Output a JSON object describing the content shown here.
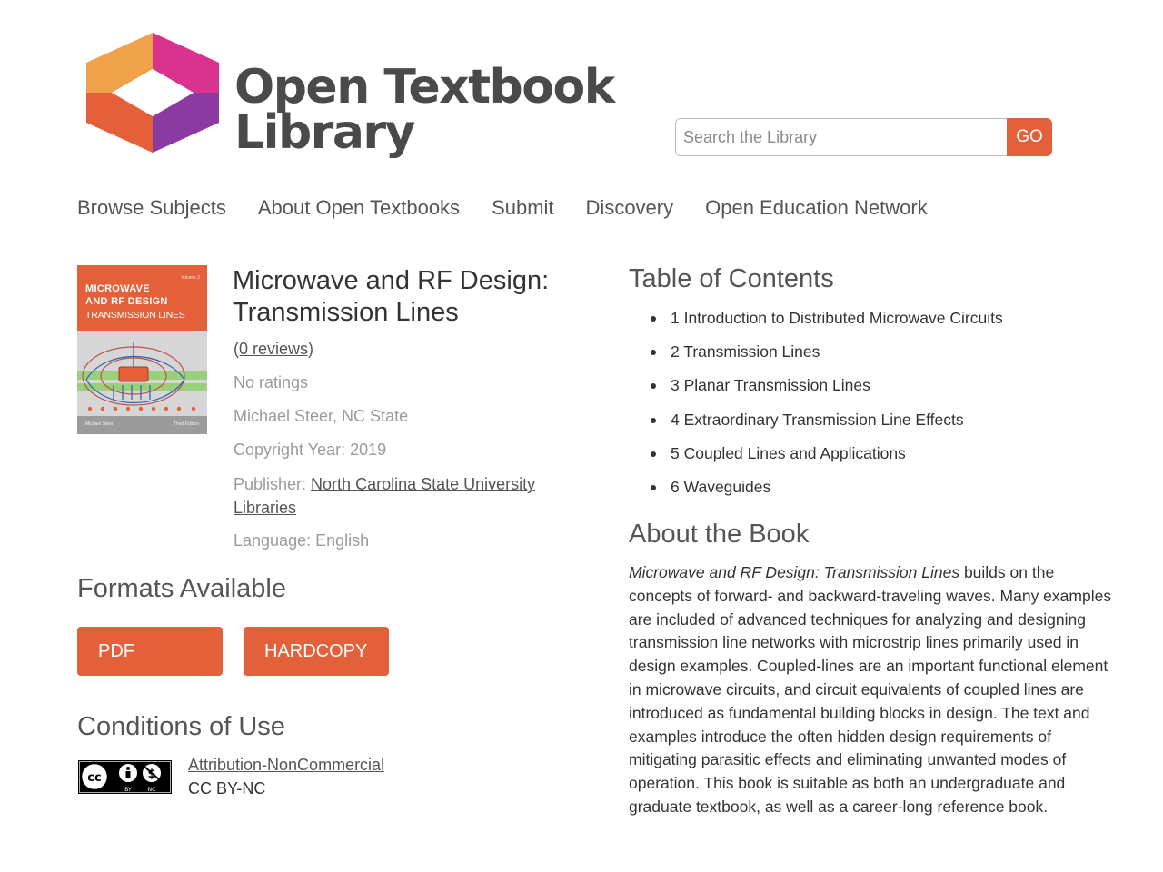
{
  "header": {
    "logo_line1": "Open Textbook",
    "logo_line2": "Library",
    "search_placeholder": "Search the Library",
    "search_value": "",
    "go_label": "GO"
  },
  "nav": [
    {
      "label": "Browse Subjects"
    },
    {
      "label": "About Open Textbooks"
    },
    {
      "label": "Submit"
    },
    {
      "label": "Discovery"
    },
    {
      "label": "Open Education Network"
    }
  ],
  "cover": {
    "volume": "Volume 2",
    "line1": "MICROWAVE",
    "line2": "AND RF DESIGN",
    "line3": "TRANSMISSION LINES",
    "author": "Michael Steer",
    "edition": "Third Edition"
  },
  "book": {
    "title": "Microwave and RF Design: Transmission Lines",
    "reviews": "(0 reviews)",
    "ratings": "No ratings",
    "author": "Michael Steer, NC State",
    "copyright": "Copyright Year: 2019",
    "publisher_label": "Publisher: ",
    "publisher": "North Carolina State University Libraries",
    "language": "Language: English"
  },
  "formats": {
    "heading": "Formats Available",
    "pdf_label": "PDF",
    "hardcopy_label": "HARDCOPY"
  },
  "conditions": {
    "heading": "Conditions of Use",
    "license_name": "Attribution-NonCommercial",
    "license_code": "CC BY-NC"
  },
  "toc": {
    "heading": "Table of Contents",
    "items": [
      "1 Introduction to Distributed Microwave Circuits",
      "2 Transmission Lines",
      "3 Planar Transmission Lines",
      "4 Extraordinary Transmission Line Effects",
      "5 Coupled Lines and Applications",
      "6 Waveguides"
    ]
  },
  "about": {
    "heading": "About the Book",
    "title_italic": "Microwave and RF Design: Transmission Lines",
    "body": " builds on the concepts of forward- and backward-traveling waves. Many examples are included of advanced techniques for analyzing and designing transmission line networks with microstrip lines primarily used in design examples. Coupled-lines are an important functional element in microwave circuits, and circuit equivalents of coupled lines are introduced as fundamental building blocks in design. The text and examples introduce the often hidden design requirements of mitigating parasitic effects and eliminating unwanted modes of operation. This book is suitable as both an undergraduate and graduate textbook, as well as a career-long reference book."
  },
  "colors": {
    "accent": "#e4603b",
    "logo_orange": "#f0a24a",
    "logo_red": "#e4603b",
    "logo_magenta": "#d9338f",
    "logo_purple": "#8a3aa0"
  }
}
